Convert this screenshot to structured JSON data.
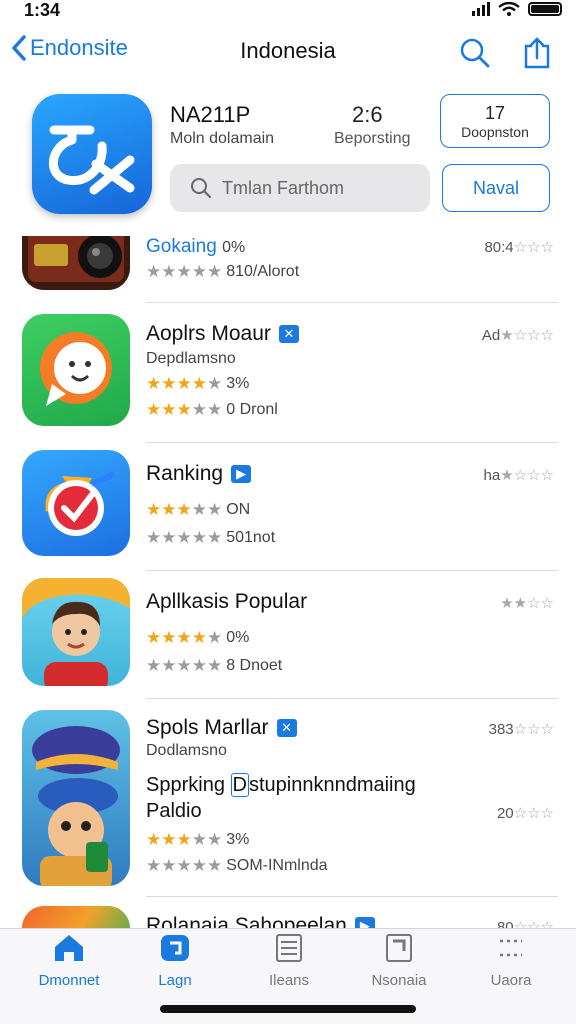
{
  "status_bar": {
    "time": "1:34"
  },
  "nav": {
    "back_label": "Endonsite",
    "title": "Indonesia"
  },
  "header": {
    "app_code": "NA211P",
    "app_sub": "Moln dolamain",
    "rank_value": "2:6",
    "rank_label": "Beporsting",
    "btn_top_line1": "17",
    "btn_top_line2": "Doopnston",
    "search_placeholder": "Tmlan Farthom",
    "btn_nav_label": "Naval"
  },
  "rows": [
    {
      "name": "Gokaing",
      "pct": "0%",
      "rating_text": "810/Alorot",
      "right": "80:4"
    },
    {
      "name": "Aoplrs Moaur",
      "sub": "Depdlamsno",
      "pct": "3%",
      "rating_text": "0 Dronl",
      "right": "Ad"
    },
    {
      "name": "Ranking",
      "pct": "ON",
      "rating_text": "501not",
      "right": "ha"
    },
    {
      "name": "Apllkasis Popular",
      "pct": "0%",
      "rating_text": "8 Dnoet",
      "right": ""
    },
    {
      "name": "Spols Marllar",
      "sub": "Dodlamsno",
      "multi_1": "Spprking",
      "multi_hl": "D",
      "multi_2": "stupinnknndmaiing",
      "multi_3": "Paldio",
      "pct": "3%",
      "rating_text": "SOM-INmlnda",
      "right_top": "383",
      "right_mid": "20"
    },
    {
      "name": "Rolanaia Sahopeelan",
      "right": "80"
    }
  ],
  "tabs": [
    {
      "label": "Dmonnet"
    },
    {
      "label": "Lagn"
    },
    {
      "label": "Ileans"
    },
    {
      "label": "Nsonaia"
    },
    {
      "label": "Uaora"
    }
  ],
  "colors": {
    "accent": "#1a7ae0",
    "star_gold": "#f2a516",
    "star_gray": "#9c9c9c"
  }
}
